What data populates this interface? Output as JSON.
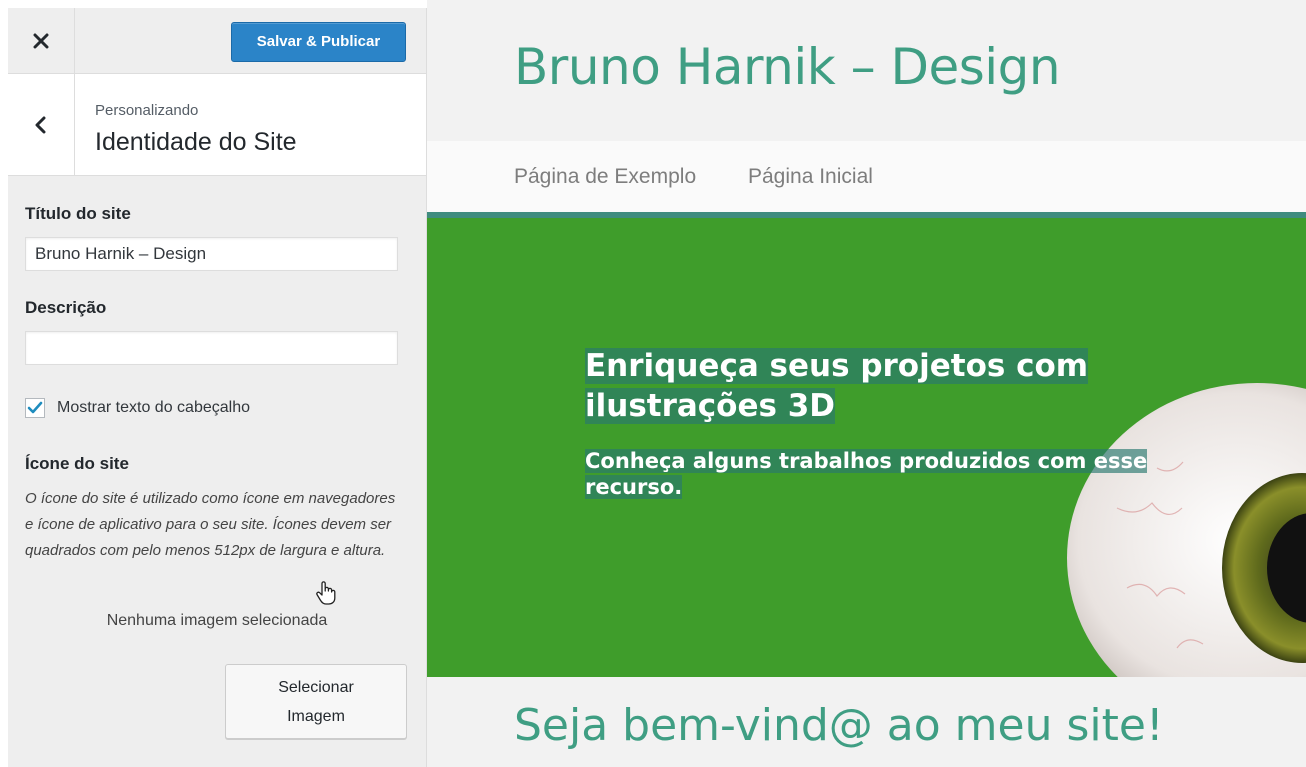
{
  "customizer": {
    "close_icon": "close-icon",
    "publish_label": "Salvar & Publicar",
    "back_icon": "chevron-left-icon",
    "breadcrumb_small": "Personalizando",
    "section_title": "Identidade do Site",
    "site_title_label": "Título do site",
    "site_title_value": "Bruno Harnik – Design",
    "description_label": "Descrição",
    "description_value": "",
    "show_header_text_label": "Mostrar texto do cabeçalho",
    "show_header_text_checked": true,
    "site_icon_label": "Ícone do site",
    "site_icon_description": "O ícone do site é utilizado como ícone em navegadores e ícone de aplicativo para o seu site. Ícones devem ser quadrados com pelo menos 512px de largura e altura.",
    "no_image_text": "Nenhuma imagem selecionada",
    "select_image_line1": "Selecionar",
    "select_image_line2": "Imagem"
  },
  "preview": {
    "site_title": "Bruno Harnik – Design",
    "menu": [
      "Página de Exemplo",
      "Página Inicial"
    ],
    "hero_title": "Enriqueça seus projetos com ilustrações 3D",
    "hero_subtitle": "Conheça alguns trabalhos produzidos com esse recurso.",
    "welcome_heading": "Seja bem-vind@ ao meu site!"
  },
  "colors": {
    "primary_button": "#2b84c8",
    "site_accent": "#3f9e83",
    "hero_background": "#3f9d2b",
    "checkbox_check": "#1e8cbe"
  }
}
